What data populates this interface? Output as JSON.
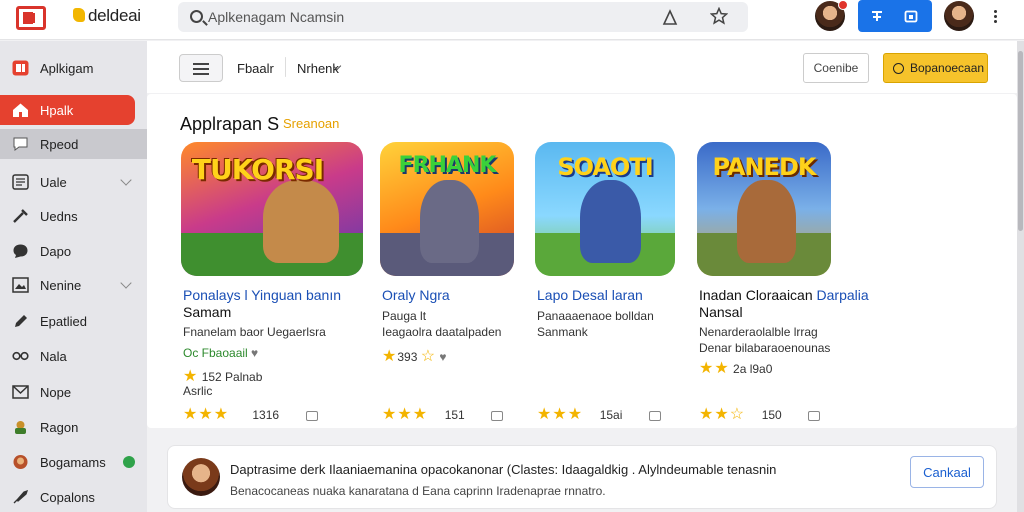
{
  "brand": {
    "name": "deldeai"
  },
  "search": {
    "placeholder": "Aplkenagam Ncamsin"
  },
  "colors": {
    "accent": "#e5412f",
    "primary": "#1a73e8",
    "highlight": "#f6c32b"
  },
  "sidebar": {
    "header": "Aplkigam",
    "items": [
      {
        "label": "Hpalk",
        "icon": "home-icon"
      },
      {
        "label": "Rpeod",
        "icon": "chat-icon"
      },
      {
        "label": "Uale",
        "icon": "list-icon"
      },
      {
        "label": "Uedns",
        "icon": "tools-icon"
      },
      {
        "label": "Dapo",
        "icon": "chat-bubble-icon"
      },
      {
        "label": "Nenine",
        "icon": "image-icon"
      },
      {
        "label": "Epatlied",
        "icon": "pen-icon"
      },
      {
        "label": "Nala",
        "icon": "glasses-icon"
      },
      {
        "label": "Nope",
        "icon": "mail-icon"
      },
      {
        "label": "Ragon",
        "icon": "game-icon"
      },
      {
        "label": "Bogamams",
        "icon": "game2-icon"
      },
      {
        "label": "Copalons",
        "icon": "rocket-icon"
      }
    ]
  },
  "toolbar": {
    "filter1": "Fbaalr",
    "filter2": "Nrhenk",
    "btn_outline": "Coenibe",
    "btn_yellow": "Bopanoecaan"
  },
  "section": {
    "title": "Applrapan S",
    "link": "Sreanoan"
  },
  "games": [
    {
      "art": "TUKORSI",
      "name1": "Ponalays l Yinguan banın",
      "name2": "Samam",
      "desc1": "Fnanelam baor Uegaerlsra",
      "meta1": "Oc  Fbaoaail",
      "meta2": "152  Palnab",
      "meta3": "Asrlic",
      "count": "1316"
    },
    {
      "art": "FRHANK",
      "name1": "Oraly Ngra",
      "desc1": "Pauga lt",
      "desc2": "Ieagaolra daatalpaden",
      "rating": "393",
      "count": "151"
    },
    {
      "art": "SOAOTI",
      "name1": "Lapo Desal laran",
      "desc1": "Panaaaenaoe bolldan",
      "desc2": "Sanmank",
      "count": "15ai"
    },
    {
      "art": "PANEDK",
      "name1": "Inadan Cloraaican",
      "name1b": "Darpalia",
      "name2": "Nansal",
      "desc1": "Nenarderaolalble lrrag",
      "desc2": "Denar bilabaraoenounas",
      "meta2": "2a  l9a0",
      "count": "150"
    }
  ],
  "bottom": {
    "title": "Daptrasime derk  Ilaaniaemanina opacokanonar (Clastes: Idaagaldkig .  Alylndeumable tenasnin",
    "sub": "Benacocaneas nuaka kanaratana d Eana caprinn Iradenaprae rnnatro.",
    "cancel": "Cankaal"
  }
}
